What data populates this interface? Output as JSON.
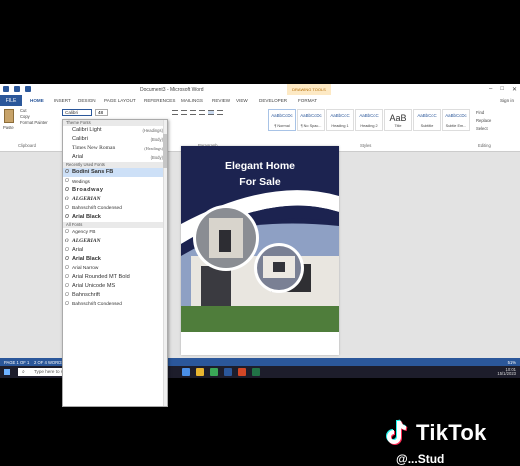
{
  "window": {
    "title": "Document3 - Microsoft Word",
    "drawing_tools": "DRAWING TOOLS",
    "min_glyph": "–",
    "max_glyph": "□",
    "close_glyph": "✕"
  },
  "tabs": [
    "HOME",
    "INSERT",
    "DESIGN",
    "PAGE LAYOUT",
    "REFERENCES",
    "MAILINGS",
    "REVIEW",
    "VIEW",
    "DEVELOPER",
    "FORMAT"
  ],
  "file_tab": "FILE",
  "sign_in": "Sign in",
  "clipboard": {
    "paste": "Paste",
    "cut": "Cut",
    "copy": "Copy",
    "format_painter": "Format Painter",
    "group": "Clipboard"
  },
  "font": {
    "current": "Calibri",
    "size": "48"
  },
  "groups": {
    "paragraph": "Paragraph",
    "styles": "Styles",
    "editing": "Editing"
  },
  "styles": [
    {
      "sample": "AaBbCcDc",
      "name": "¶ Normal"
    },
    {
      "sample": "AaBbCcDc",
      "name": "¶ No Spac..."
    },
    {
      "sample": "AaBbCcC",
      "name": "Heading 1"
    },
    {
      "sample": "AaBbCcC",
      "name": "Heading 2"
    },
    {
      "sample": "AaB",
      "name": "Title"
    },
    {
      "sample": "AaBbCcC",
      "name": "Subtitle"
    },
    {
      "sample": "AaBbCcDc",
      "name": "Subtle Em..."
    }
  ],
  "editing": {
    "find": "Find",
    "replace": "Replace",
    "select": "Select"
  },
  "font_dropdown": {
    "theme_header": "Theme Fonts",
    "theme": [
      {
        "name": "Calibri Light",
        "tag": "(Headings)"
      },
      {
        "name": "Calibri",
        "tag": "(Body)"
      },
      {
        "name": "Times New Roman",
        "tag": "(Headings)"
      },
      {
        "name": "Arial",
        "tag": "(Body)"
      }
    ],
    "recent_header": "Recently Used Fonts",
    "recent": [
      "Bodini Sans FB",
      "Wedings",
      "Broadway",
      "ALGERIAN",
      "Bahnschrift Condensed",
      "Arial Black"
    ],
    "all_header": "All Fonts",
    "all": [
      "Agency FB",
      "ALGERIAN",
      "Arial",
      "Arial Black",
      "Arial Narrow",
      "Arial Rounded MT Bold",
      "Arial Unicode MS",
      "Bahnschrift",
      "Bahnschrift Condensed"
    ]
  },
  "poster": {
    "line1": "Elegant Home",
    "line2": "For Sale"
  },
  "status": {
    "page": "PAGE 1 OF 1",
    "words": "2 OF 4 WORDS",
    "language": "ENGLISH (UNITED STATES)",
    "zoom": "51%"
  },
  "taskbar": {
    "search": "Type here to search",
    "time": "10:01",
    "date": "15/1/2023"
  },
  "watermark": {
    "brand": "TikTok",
    "handle": "@...Stud"
  }
}
